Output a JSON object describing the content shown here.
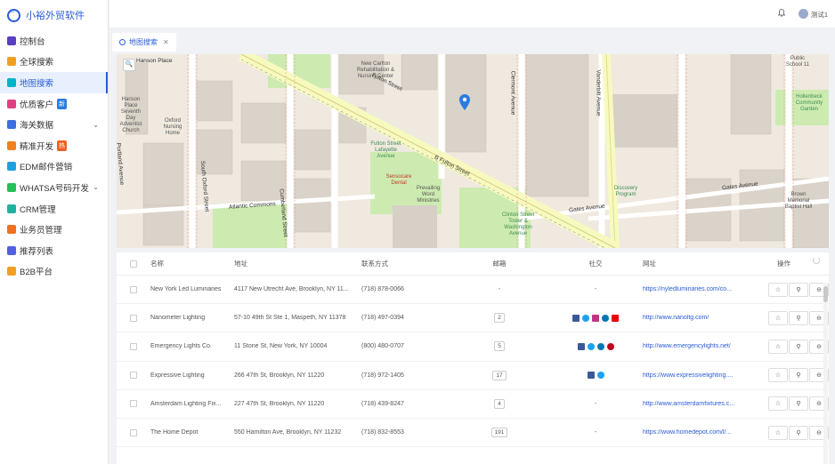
{
  "app": {
    "title": "小裕外贸软件"
  },
  "sidebar": {
    "items": [
      {
        "label": "控制台",
        "icon": "dashboard-icon",
        "color": "#5a3fc0"
      },
      {
        "label": "全球搜索",
        "icon": "globe-search-icon",
        "color": "#f0a020"
      },
      {
        "label": "地图搜索",
        "icon": "map-icon",
        "color": "#00b4c8",
        "active": true
      },
      {
        "label": "优质客户",
        "icon": "star-user-icon",
        "color": "#e04080",
        "badge": "新",
        "badge_color": "#2a7be0"
      },
      {
        "label": "海关数据",
        "icon": "customs-icon",
        "color": "#3b6ee0",
        "has_arrow": true
      },
      {
        "label": "精准开发",
        "icon": "target-icon",
        "color": "#f08020",
        "badge": "热",
        "badge_color": "#f06020"
      },
      {
        "label": "EDM邮件营销",
        "icon": "mail-icon",
        "color": "#20a0e0"
      },
      {
        "label": "WHATSA号码开发",
        "icon": "whatsapp-icon",
        "color": "#25c05a",
        "has_arrow": true
      },
      {
        "label": "CRM管理",
        "icon": "crm-icon",
        "color": "#20b0a0"
      },
      {
        "label": "业务员管理",
        "icon": "team-icon",
        "color": "#f07020"
      },
      {
        "label": "推荐列表",
        "icon": "recommend-icon",
        "color": "#5060e0"
      },
      {
        "label": "B2B平台",
        "icon": "b2b-icon",
        "color": "#f0a020"
      }
    ]
  },
  "header": {
    "user_name": "测试1"
  },
  "tabs": [
    {
      "label": "地图搜索"
    }
  ],
  "map": {
    "labels": {
      "fulton_street": "Fulton Street",
      "b_fulton_street": "B Fulton Street",
      "gates_avenue": "Gates Avenue",
      "atlantic_commons": "Atlantic Commons",
      "vanderbilt_avenue": "Vanderbilt Avenue",
      "clermont_avenue": "Clermont Avenue",
      "cumberland_street": "Cumberland Street",
      "south_oxford_street": "South Oxford Street",
      "portland_avenue": "Portland Avenue",
      "carlton_avenue": "Carlton Avenue",
      "washington_avenue": "Washington Avenue",
      "hanson_place": "Hanson Place",
      "hanson_church": "Hanson Place Seventh Day Adventist Church",
      "oxford_nursing": "Oxford Nursing Home",
      "new_carlton": "New Carlton Rehabilitation & Nursing Center",
      "fulton_station": "Fulton Street Lafayette Avenue",
      "sensocare": "Sensocare Dental",
      "prevailing_word": "Prevailing Word Ministries",
      "clinton_station": "Clinton Street Tower & Washington Avenue",
      "brown_memorial": "Brown Memorial Baptist Hall",
      "public_school": "Public School 11",
      "discovery_program": "Discovery Program",
      "hollenbeck": "Hollenbeck Community Garden"
    }
  },
  "table": {
    "headers": {
      "name": "名称",
      "address": "地址",
      "contact": "联系方式",
      "email": "邮箱",
      "social": "社交",
      "website": "网址",
      "ops": "操作"
    },
    "rows": [
      {
        "name": "New York Led Luminaries",
        "address": "4117 New Utrecht Ave, Brooklyn, NY 11...",
        "phone": "(718) 878-0066",
        "email": "-",
        "social": [],
        "social_text": "-",
        "website": "https://nyledluminaries.com/co..."
      },
      {
        "name": "Nanometer Lighting",
        "address": "57-10 49th St Ste 1, Maspeth, NY 11378",
        "phone": "(718) 497-0394",
        "email": "2",
        "social": [
          "facebook-icon",
          "twitter-icon",
          "instagram-icon",
          "linkedin-icon",
          "youtube-icon"
        ],
        "social_text": "",
        "website": "http://www.nanoltg.com/"
      },
      {
        "name": "Emergency Lights Co.",
        "address": "11 Stone St, New York, NY 10004",
        "phone": "(800) 480-0707",
        "email": "5",
        "social": [
          "facebook-icon",
          "twitter-icon",
          "linkedin-icon",
          "pinterest-icon"
        ],
        "social_text": "",
        "website": "http://www.emergencylights.net/"
      },
      {
        "name": "Expressive Lighting",
        "address": "266 47th St, Brooklyn, NY 11220",
        "phone": "(718) 972-1405",
        "email": "17",
        "social": [
          "facebook-icon",
          "twitter-icon"
        ],
        "social_text": "",
        "website": "https://www.expressivelighting...."
      },
      {
        "name": "Amsterdam Lighting Fix...",
        "address": "227 47th St, Brooklyn, NY 11220",
        "phone": "(718) 439-8247",
        "email": "4",
        "social": [],
        "social_text": "-",
        "website": "http://www.amsterdamfixtures.c..."
      },
      {
        "name": "The Home Depot",
        "address": "550 Hamilton Ave, Brooklyn, NY 11232",
        "phone": "(718) 832-8553",
        "email": "191",
        "social": [],
        "social_text": "-",
        "website": "https://www.homedepot.com/l/..."
      }
    ]
  }
}
